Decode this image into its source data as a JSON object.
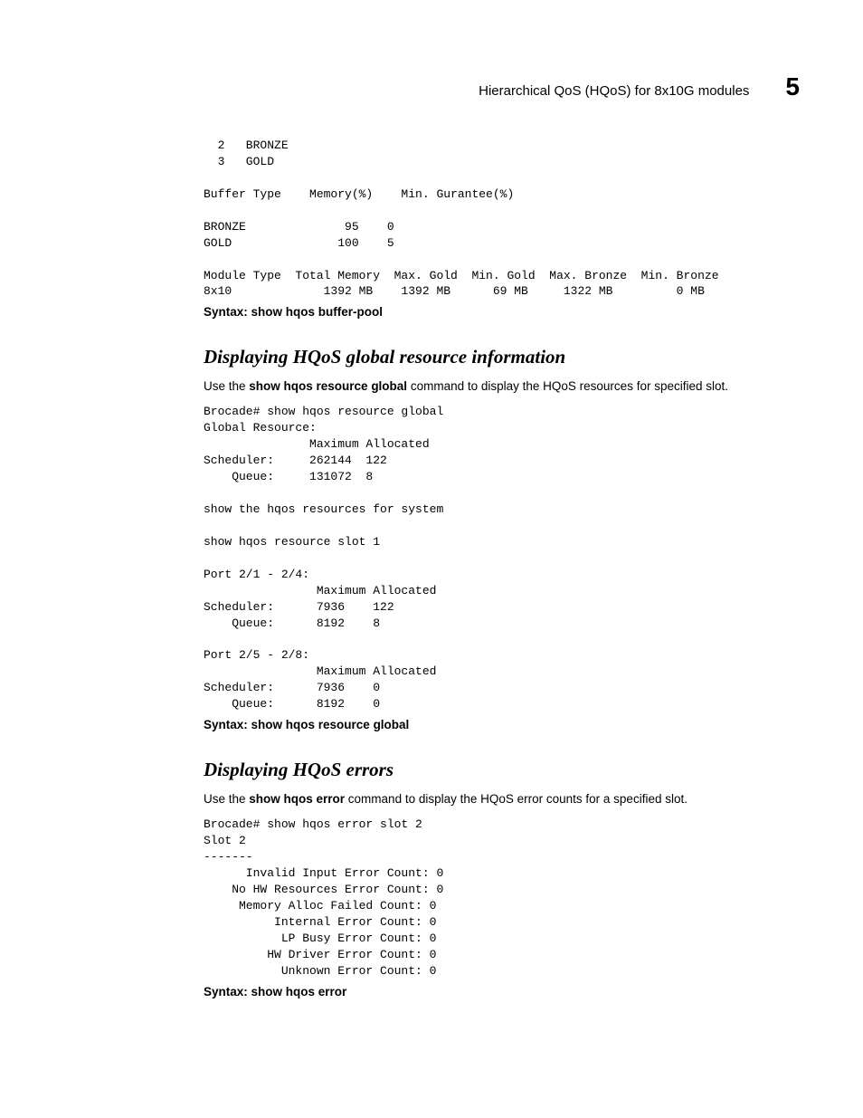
{
  "header": {
    "title": "Hierarchical QoS (HQoS) for 8x10G modules",
    "chapter_num": "5"
  },
  "block1": {
    "text": "  2   BRONZE\n  3   GOLD\n\nBuffer Type    Memory(%)    Min. Gurantee(%)\n\nBRONZE              95    0\nGOLD               100    5\n\nModule Type  Total Memory  Max. Gold  Min. Gold  Max. Bronze  Min. Bronze\n8x10             1392 MB    1392 MB      69 MB     1322 MB         0 MB"
  },
  "syntax1": {
    "prefix": "Syntax:  ",
    "cmd": "show hqos buffer-pool"
  },
  "sectionA": {
    "heading": "Displaying HQoS global resource information",
    "para_pre": "Use the ",
    "para_cmd": "show hqos resource global",
    "para_post": " command to display the HQoS resources for specified slot."
  },
  "block2": {
    "text": "Brocade# show hqos resource global\nGlobal Resource:\n               Maximum Allocated\nScheduler:     262144  122\n    Queue:     131072  8\n\nshow the hqos resources for system\n\nshow hqos resource slot 1\n\nPort 2/1 - 2/4:\n                Maximum Allocated\nScheduler:      7936    122\n    Queue:      8192    8\n\nPort 2/5 - 2/8:\n                Maximum Allocated\nScheduler:      7936    0\n    Queue:      8192    0"
  },
  "syntax2": {
    "prefix": "Syntax:  ",
    "cmd": "show hqos resource global"
  },
  "sectionB": {
    "heading": "Displaying HQoS errors",
    "para_pre": "Use the ",
    "para_cmd": "show hqos error",
    "para_post": " command to display the HQoS error counts for a specified slot."
  },
  "block3": {
    "text": "Brocade# show hqos error slot 2\nSlot 2\n-------\n      Invalid Input Error Count: 0\n    No HW Resources Error Count: 0\n     Memory Alloc Failed Count: 0\n          Internal Error Count: 0\n           LP Busy Error Count: 0\n         HW Driver Error Count: 0\n           Unknown Error Count: 0"
  },
  "syntax3": {
    "prefix": "Syntax:  ",
    "cmd": "show hqos error"
  }
}
